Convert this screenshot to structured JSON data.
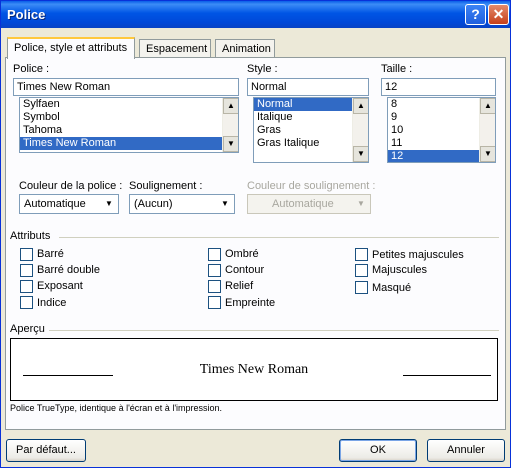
{
  "window": {
    "title": "Police",
    "help_glyph": "?",
    "close_glyph": "✕"
  },
  "tabs": [
    {
      "label": "Police, style et attributs",
      "active": true
    },
    {
      "label": "Espacement",
      "active": false
    },
    {
      "label": "Animation",
      "active": false
    }
  ],
  "font": {
    "label": "Police :",
    "value": "Times New Roman",
    "items": [
      "Sylfaen",
      "Symbol",
      "Tahoma",
      "Times New Roman"
    ],
    "selected_index": 3
  },
  "style": {
    "label": "Style :",
    "value": "Normal",
    "items": [
      "Normal",
      "Italique",
      "Gras",
      "Gras Italique"
    ],
    "selected_index": 0
  },
  "size": {
    "label": "Taille :",
    "value": "12",
    "items": [
      "8",
      "9",
      "10",
      "11",
      "12"
    ],
    "selected_index": 4
  },
  "font_color": {
    "label": "Couleur de la police :",
    "value": "Automatique"
  },
  "underline": {
    "label": "Soulignement :",
    "value": "(Aucun)"
  },
  "underline_color": {
    "label": "Couleur de soulignement :",
    "value": "Automatique"
  },
  "attributes": {
    "title": "Attributs",
    "col1": [
      "Barré",
      "Barré double",
      "Exposant",
      "Indice"
    ],
    "col2": [
      "Ombré",
      "Contour",
      "Relief",
      "Empreinte"
    ],
    "col3": [
      "Petites majuscules",
      "Majuscules",
      "Masqué"
    ]
  },
  "preview": {
    "title": "Aperçu",
    "text": "Times New Roman",
    "note": "Police TrueType, identique à l'écran et à l'impression."
  },
  "buttons": {
    "default": "Par défaut...",
    "ok": "OK",
    "cancel": "Annuler"
  },
  "icons": {
    "scroll_up": "▲",
    "scroll_down": "▼",
    "dropdown": "▼"
  },
  "colors": {
    "title_bar": "#0055e5",
    "selection": "#316ac5",
    "dialog_bg": "#ece9d8"
  }
}
